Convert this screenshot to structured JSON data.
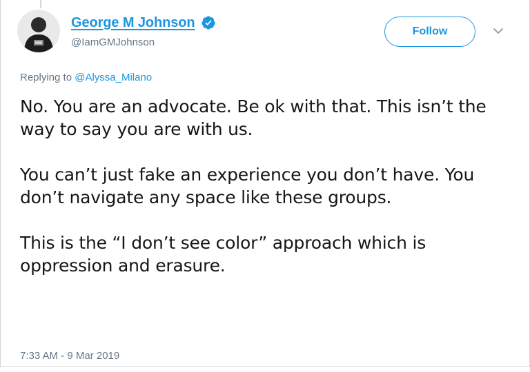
{
  "tweet": {
    "author": {
      "display_name": "George M Johnson",
      "handle": "@IamGMJohnson",
      "verified": true,
      "avatar_icon": "avatar-photo"
    },
    "follow_label": "Follow",
    "replying": {
      "prefix": "Replying to ",
      "handle": "@Alyssa_Milano"
    },
    "paragraphs": [
      "No. You are an advocate. Be ok with that. This isn’t the way to say you are with us.",
      "You can’t just fake an experience you don’t have. You don’t navigate any space like these groups.",
      "This is the “I don’t see color” approach which is oppression and erasure."
    ],
    "timestamp": "7:33 AM - 9 Mar 2019"
  },
  "colors": {
    "accent": "#1b95e0",
    "secondary_text": "#657786",
    "body_text": "#14171a"
  },
  "icons": {
    "verified": "verified-badge-icon",
    "menu": "chevron-down-icon"
  }
}
